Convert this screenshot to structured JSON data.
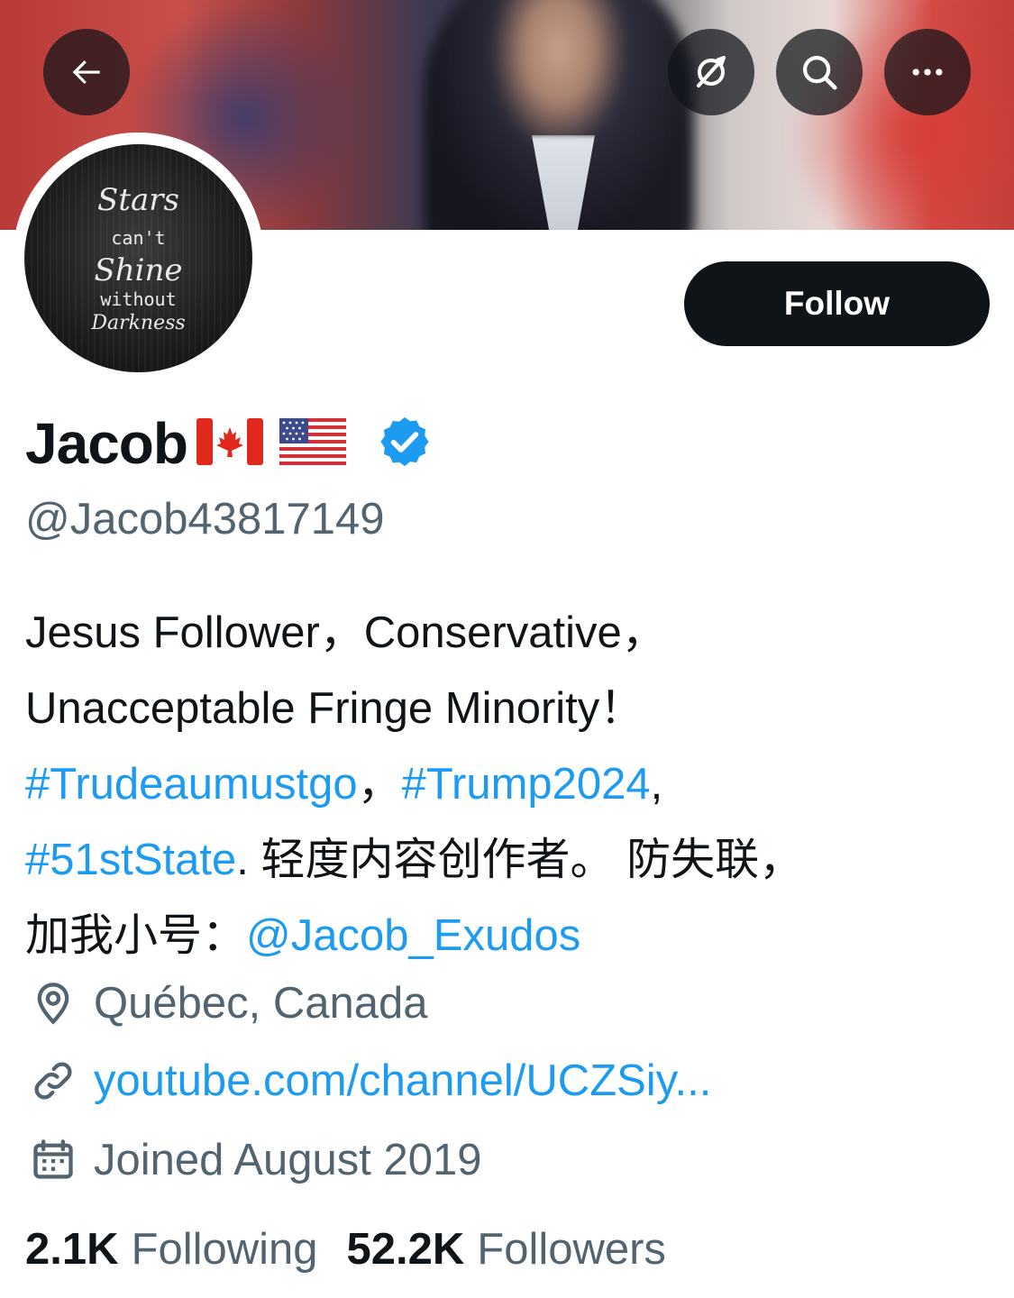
{
  "header": {
    "back_icon": "arrow-left-icon",
    "actions": [
      "notifications-off-icon",
      "search-icon",
      "more-icon"
    ]
  },
  "avatar": {
    "lines": [
      "Stars",
      "can't",
      "Shine",
      "without",
      "Darkness"
    ]
  },
  "follow_button": {
    "label": "Follow"
  },
  "profile": {
    "name": "Jacob",
    "flags": [
      "canada-flag",
      "us-flag"
    ],
    "verified": true,
    "handle": "@Jacob43817149"
  },
  "bio": {
    "line1": "Jesus Follower，Conservative，",
    "line2": "Unacceptable Fringe Minority！",
    "hashtag1": "#Trudeaumustgo",
    "sep1": "，",
    "hashtag2": "#Trump2024",
    "sep2": ",",
    "hashtag3": "#51stState",
    "text3": ". 轻度内容创作者。 防失联，",
    "text4": "加我小号：",
    "mention": "@Jacob_Exudos"
  },
  "meta": {
    "location": "Québec, Canada",
    "website": "youtube.com/channel/UCZSiy...",
    "joined": "Joined August 2019"
  },
  "stats": {
    "following_count": "2.1K",
    "following_label": "Following",
    "followers_count": "52.2K",
    "followers_label": "Followers"
  },
  "colors": {
    "link": "#1d9bf0",
    "secondary_text": "#536471",
    "primary_text": "#0f1419",
    "verified": "#1d9bf0"
  }
}
